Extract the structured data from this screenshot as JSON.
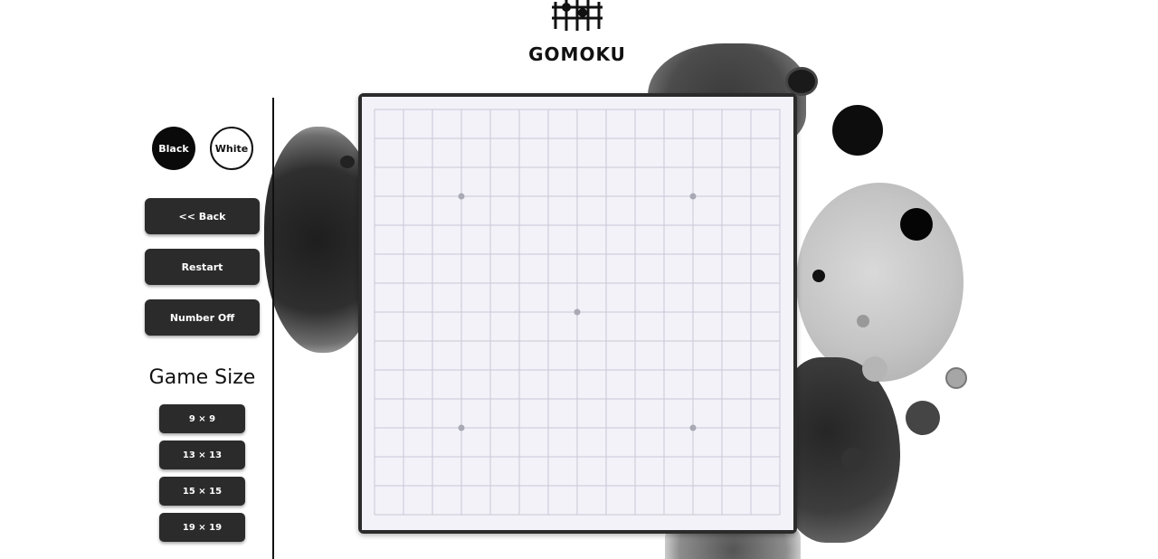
{
  "header": {
    "title": "GOMOKU",
    "logo_icon": "gomoku-board-icon"
  },
  "players": {
    "black_label": "Black",
    "white_label": "White"
  },
  "controls": {
    "back_label": "<< Back",
    "restart_label": "Restart",
    "number_label": "Number Off"
  },
  "game_size": {
    "title": "Game Size",
    "options": [
      "9 × 9",
      "13 × 13",
      "15 × 15",
      "19 × 19"
    ]
  },
  "board": {
    "lines": 15,
    "star_points": [
      [
        3,
        3
      ],
      [
        11,
        3
      ],
      [
        7,
        7
      ],
      [
        3,
        11
      ],
      [
        11,
        11
      ]
    ],
    "line_color": "#c9c7d6",
    "star_color": "#a9a9b4",
    "background": "#f3f2f8"
  },
  "colors": {
    "button_bg": "#2b2b2b",
    "button_text": "#ffffff",
    "border": "#111111"
  }
}
